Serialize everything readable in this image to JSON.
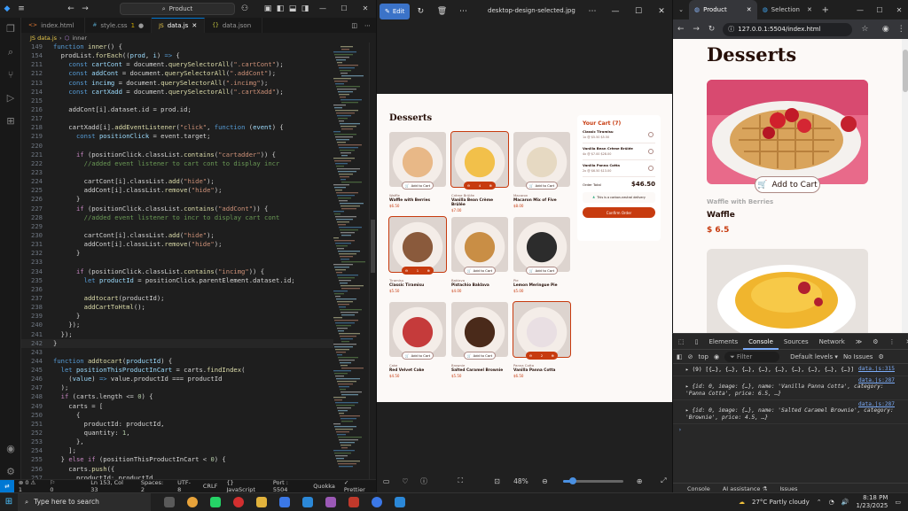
{
  "vscode": {
    "search_text": "Product",
    "tabs": [
      {
        "label": "index.html",
        "active": false,
        "modified": false
      },
      {
        "label": "style.css",
        "active": false,
        "modified": true,
        "badge": "1"
      },
      {
        "label": "data.js",
        "active": true,
        "modified": false
      },
      {
        "label": "data.json",
        "active": false,
        "modified": false
      }
    ],
    "breadcrumb": [
      "JS data.js",
      "inner"
    ],
    "code_lines": [
      {
        "n": "149",
        "html": "<span class=\"kw\">function</span> <span class=\"fn\">inner</span>() {"
      },
      {
        "n": "154",
        "html": "  prodList.<span class=\"fn\">forEach</span>((<span class=\"vr\">prod</span>, <span class=\"vr\">i</span>) <span class=\"kw\">=&gt;</span> {"
      },
      {
        "n": "211",
        "html": "    <span class=\"kw\">const</span> <span class=\"vr\">cartCont</span> = document.<span class=\"fn\">querySelectorAll</span>(<span class=\"str\">\".cartCont\"</span>);"
      },
      {
        "n": "212",
        "html": "    <span class=\"kw\">const</span> <span class=\"vr\">addCont</span> = document.<span class=\"fn\">querySelectorAll</span>(<span class=\"str\">\".addCont\"</span>);"
      },
      {
        "n": "213",
        "html": "    <span class=\"kw\">const</span> <span class=\"vr\">incimg</span> = document.<span class=\"fn\">querySelectorAll</span>(<span class=\"str\">\".incimg\"</span>);"
      },
      {
        "n": "214",
        "html": "    <span class=\"kw\">const</span> <span class=\"vr\">cartXadd</span> = document.<span class=\"fn\">querySelectorAll</span>(<span class=\"str\">\".cartXadd\"</span>);"
      },
      {
        "n": "215",
        "html": ""
      },
      {
        "n": "216",
        "html": "    addCont[i].dataset.id = prod.id;"
      },
      {
        "n": "217",
        "html": ""
      },
      {
        "n": "218",
        "html": "    cartXadd[i].<span class=\"fn\">addEventListener</span>(<span class=\"str\">\"click\"</span>, <span class=\"kw\">function</span> (<span class=\"vr\">event</span>) {"
      },
      {
        "n": "219",
        "html": "      <span class=\"kw\">const</span> <span class=\"vr\">positionClick</span> = event.target;"
      },
      {
        "n": "220",
        "html": ""
      },
      {
        "n": "221",
        "html": "      <span class=\"pu\">if</span> (positionClick.classList.<span class=\"fn\">contains</span>(<span class=\"str\">\"cartadder\"</span>)) {"
      },
      {
        "n": "222",
        "html": "        <span class=\"cm\">//added event listener to cart cont to display incr</span>"
      },
      {
        "n": "223",
        "html": ""
      },
      {
        "n": "224",
        "html": "        cartCont[i].classList.<span class=\"fn\">add</span>(<span class=\"str\">\"hide\"</span>);"
      },
      {
        "n": "225",
        "html": "        addCont[i].classList.<span class=\"fn\">remove</span>(<span class=\"str\">\"hide\"</span>);"
      },
      {
        "n": "226",
        "html": "      }"
      },
      {
        "n": "227",
        "html": "      <span class=\"pu\">if</span> (positionClick.classList.<span class=\"fn\">contains</span>(<span class=\"str\">\"addCont\"</span>)) {"
      },
      {
        "n": "228",
        "html": "        <span class=\"cm\">//added event listener to incr to display cart cont</span>"
      },
      {
        "n": "229",
        "html": ""
      },
      {
        "n": "230",
        "html": "        cartCont[i].classList.<span class=\"fn\">add</span>(<span class=\"str\">\"hide\"</span>);"
      },
      {
        "n": "231",
        "html": "        addCont[i].classList.<span class=\"fn\">remove</span>(<span class=\"str\">\"hide\"</span>);"
      },
      {
        "n": "232",
        "html": "      }"
      },
      {
        "n": "233",
        "html": ""
      },
      {
        "n": "234",
        "html": "      <span class=\"pu\">if</span> (positionClick.classList.<span class=\"fn\">contains</span>(<span class=\"str\">\"incimg\"</span>)) {"
      },
      {
        "n": "235",
        "html": "        <span class=\"kw\">let</span> <span class=\"vr\">productId</span> = positionClick.parentElement.dataset.id;"
      },
      {
        "n": "236",
        "html": ""
      },
      {
        "n": "237",
        "html": "        <span class=\"fn\">addtocart</span>(productId);"
      },
      {
        "n": "238",
        "html": "        <span class=\"fn\">addCartToHtml</span>();"
      },
      {
        "n": "239",
        "html": "      }"
      },
      {
        "n": "240",
        "html": "    });"
      },
      {
        "n": "241",
        "html": "  });"
      },
      {
        "n": "242",
        "html": "}"
      },
      {
        "n": "243",
        "html": ""
      },
      {
        "n": "244",
        "html": "<span class=\"kw\">function</span> <span class=\"fn\">addtocart</span>(<span class=\"vr\">productId</span>) {"
      },
      {
        "n": "245",
        "html": "  <span class=\"kw\">let</span> <span class=\"vr\">positionThisProductInCart</span> = carts.<span class=\"fn\">findIndex</span>("
      },
      {
        "n": "246",
        "html": "    (<span class=\"vr\">value</span>) <span class=\"kw\">=&gt;</span> value.productId === productId"
      },
      {
        "n": "247",
        "html": "  );"
      },
      {
        "n": "248",
        "html": "  <span class=\"pu\">if</span> (carts.length &lt;= <span class=\"nm\">0</span>) {"
      },
      {
        "n": "249",
        "html": "    carts = ["
      },
      {
        "n": "250",
        "html": "      {"
      },
      {
        "n": "251",
        "html": "        productId: productId,"
      },
      {
        "n": "252",
        "html": "        quantity: <span class=\"nm\">1</span>,"
      },
      {
        "n": "253",
        "html": "      },"
      },
      {
        "n": "254",
        "html": "    ];"
      },
      {
        "n": "255",
        "html": "  } <span class=\"pu\">else if</span> (positionThisProductInCart &lt; <span class=\"nm\">0</span>) {"
      },
      {
        "n": "256",
        "html": "    carts.<span class=\"fn\">push</span>({"
      },
      {
        "n": "257",
        "html": "      productId: productId,"
      }
    ],
    "status": {
      "remote": "⇄",
      "errors": "⊗ 0 ⚠ 1",
      "warnings": "⚐ 0",
      "position": "Ln 153, Col 33",
      "spaces": "Spaces: 2",
      "encoding": "UTF-8",
      "eol": "CRLF",
      "language": "{} JavaScript",
      "port": "Port : 5504",
      "quokka": "Quokka",
      "prettier": "✓ Prettier"
    }
  },
  "viewer": {
    "edit_label": "Edit",
    "filename": "desktop-design-selected.jpg",
    "zoom": "48%",
    "zoom_fraction": 0.1
  },
  "mock": {
    "title": "Desserts",
    "items": [
      {
        "cat": "Waffle",
        "name": "Waffle with Berries",
        "price": "$6.50",
        "btn": "Add to Cart",
        "color": "#e8b887",
        "state": "add"
      },
      {
        "cat": "Crème Brûlée",
        "name": "Vanilla Bean Crème Brûlée",
        "price": "$7.00",
        "btn": "4",
        "color": "#f2c04a",
        "state": "qty"
      },
      {
        "cat": "Macaron",
        "name": "Macaron Mix of Five",
        "price": "$8.00",
        "btn": "Add to Cart",
        "color": "#e6d9c2",
        "state": "add"
      },
      {
        "cat": "Tiramisu",
        "name": "Classic Tiramisu",
        "price": "$5.50",
        "btn": "1",
        "color": "#8a5a3c",
        "state": "qty"
      },
      {
        "cat": "Baklava",
        "name": "Pistachio Baklava",
        "price": "$4.00",
        "btn": "Add to Cart",
        "color": "#c98e45",
        "state": "add"
      },
      {
        "cat": "Pie",
        "name": "Lemon Meringue Pie",
        "price": "$5.00",
        "btn": "Add to Cart",
        "color": "#2c2c2c",
        "state": "add"
      },
      {
        "cat": "Cake",
        "name": "Red Velvet Cake",
        "price": "$4.50",
        "btn": "Add to Cart",
        "color": "#c53b3b",
        "state": "add"
      },
      {
        "cat": "Brownie",
        "name": "Salted Caramel Brownie",
        "price": "$5.50",
        "btn": "Add to Cart",
        "color": "#4a2a1a",
        "state": "add"
      },
      {
        "cat": "Panna Cotta",
        "name": "Vanilla Panna Cotta",
        "price": "$6.50",
        "btn": "2",
        "color": "#e9dfe3",
        "state": "qty"
      }
    ],
    "cart": {
      "title": "Your Cart (7)",
      "rows": [
        {
          "name": "Classic Tiramisu",
          "detail": "1x @ $5.50 $5.50"
        },
        {
          "name": "Vanilla Bean Crème Brûlée",
          "detail": "4x @ $7.00 $28.00"
        },
        {
          "name": "Vanilla Panna Cotta",
          "detail": "2x @ $6.50 $13.00"
        }
      ],
      "total_label": "Order Total",
      "total": "$46.50",
      "neutral": "This is a carbon-neutral delivery",
      "confirm": "Confirm Order"
    }
  },
  "browser": {
    "tabs": [
      {
        "label": "Product",
        "active": true
      },
      {
        "label": "Selection",
        "active": false
      }
    ],
    "url": "127.0.0.1:5504/index.html",
    "page": {
      "title": "Desserts",
      "button": "Add to Cart",
      "category": "Waffle with Berries",
      "name": "Waffle",
      "price": "$ 6.5"
    }
  },
  "devtools": {
    "tabs": [
      "Elements",
      "Console",
      "Sources",
      "Network",
      "≫"
    ],
    "context": "top",
    "filter_placeholder": "Filter",
    "levels": "Default levels ▾",
    "issues": "No Issues",
    "logs": [
      {
        "src": "",
        "body": "▸ (9) [{…}, {…}, {…}, {…}, {…}, {…}, {…}, {…}, {…}]",
        "src_line": "data.js:315"
      },
      {
        "src": "data.js:287",
        "body": "{id: 0, image: {…}, name: 'Vanilla Panna Cotta', category: 'Panna Cotta', price: 6.5, …}"
      },
      {
        "src": "data.js:287",
        "body": "{id: 0, image: {…}, name: 'Salted Caramel Brownie', category: 'Brownie', price: 4.5, …}"
      }
    ],
    "footer": [
      "Console",
      "AI assistance ⚗",
      "Issues"
    ]
  },
  "taskbar": {
    "search_placeholder": "Type here to search",
    "weather": "27°C  Partly cloudy",
    "time": "8:18 PM",
    "date": "1/23/2025",
    "apps": [
      "#5a5a5a",
      "#e8a33a",
      "#25d366",
      "#d32f2f",
      "#e2b33c",
      "#3b78e7",
      "#2b88d8",
      "#9b59b6",
      "#c0392b",
      "#3b78e7",
      "#2b88d8"
    ]
  }
}
